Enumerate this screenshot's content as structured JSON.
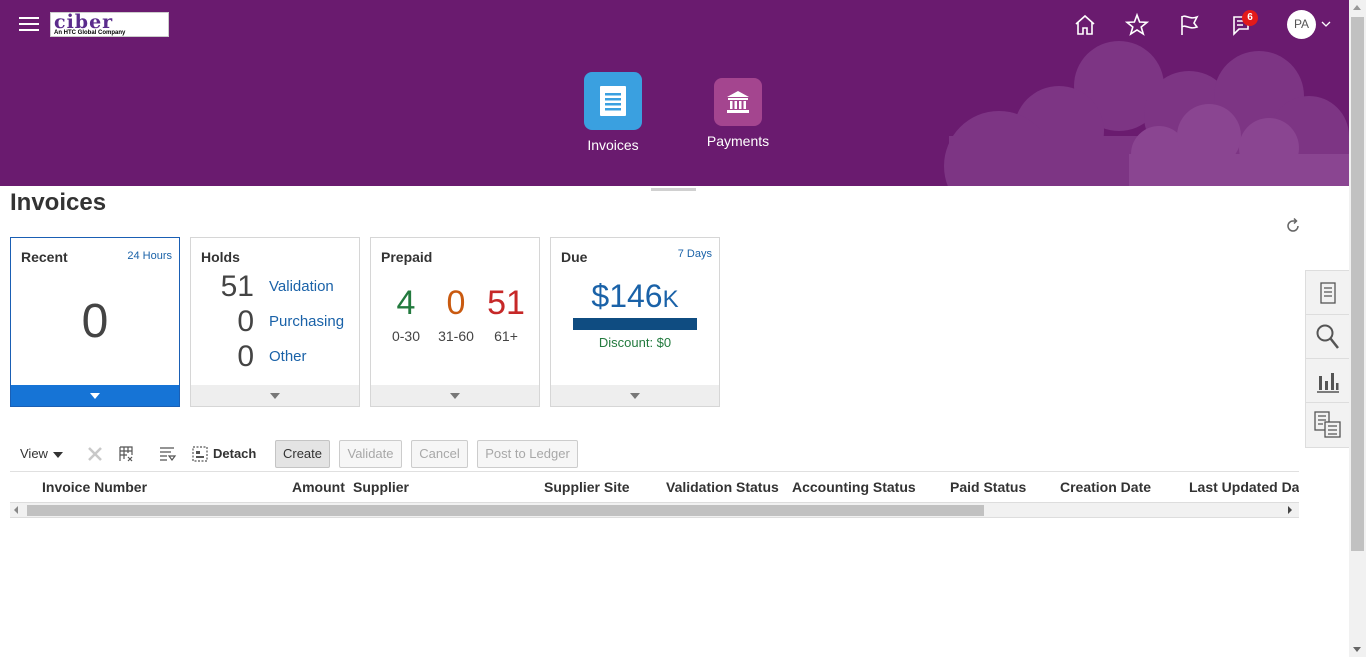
{
  "header": {
    "menu_icon": "hamburger-icon",
    "logo": {
      "word": "ciber",
      "tagline": "An HTC Global Company"
    },
    "icons": [
      "home-icon",
      "star-icon",
      "flag-icon",
      "notifications-icon"
    ],
    "notification_count": "6",
    "user_initials": "PA",
    "apps": [
      {
        "label": "Invoices",
        "color": "#3aa0e0",
        "icon": "document-icon"
      },
      {
        "label": "Payments",
        "color": "#a4458f",
        "icon": "bank-icon"
      }
    ]
  },
  "page": {
    "title": "Invoices"
  },
  "cards": {
    "recent": {
      "title": "Recent",
      "sub": "24 Hours",
      "value": "0"
    },
    "holds": {
      "title": "Holds",
      "rows": [
        {
          "count": "51",
          "label": "Validation"
        },
        {
          "count": "0",
          "label": "Purchasing"
        },
        {
          "count": "0",
          "label": "Other"
        }
      ]
    },
    "prepaid": {
      "title": "Prepaid",
      "buckets": [
        {
          "count": "4",
          "range": "0-30",
          "color": "#237a3e"
        },
        {
          "count": "0",
          "range": "31-60",
          "color": "#c95a10"
        },
        {
          "count": "51",
          "range": "61+",
          "color": "#c62828"
        }
      ]
    },
    "due": {
      "title": "Due",
      "sub": "7 Days",
      "amount": "$146",
      "suffix": "K",
      "discount": "Discount: $0"
    }
  },
  "toolbar": {
    "view_label": "View",
    "detach_label": "Detach",
    "buttons": {
      "create": "Create",
      "validate": "Validate",
      "cancel": "Cancel",
      "post": "Post to Ledger"
    }
  },
  "table": {
    "columns": [
      "Invoice Number",
      "Amount",
      "Supplier",
      "Supplier Site",
      "Validation Status",
      "Accounting Status",
      "Paid Status",
      "Creation Date",
      "Last Updated Date"
    ]
  },
  "side_panel": [
    "tasks-icon",
    "search-icon",
    "analytics-icon",
    "reports-icon"
  ]
}
